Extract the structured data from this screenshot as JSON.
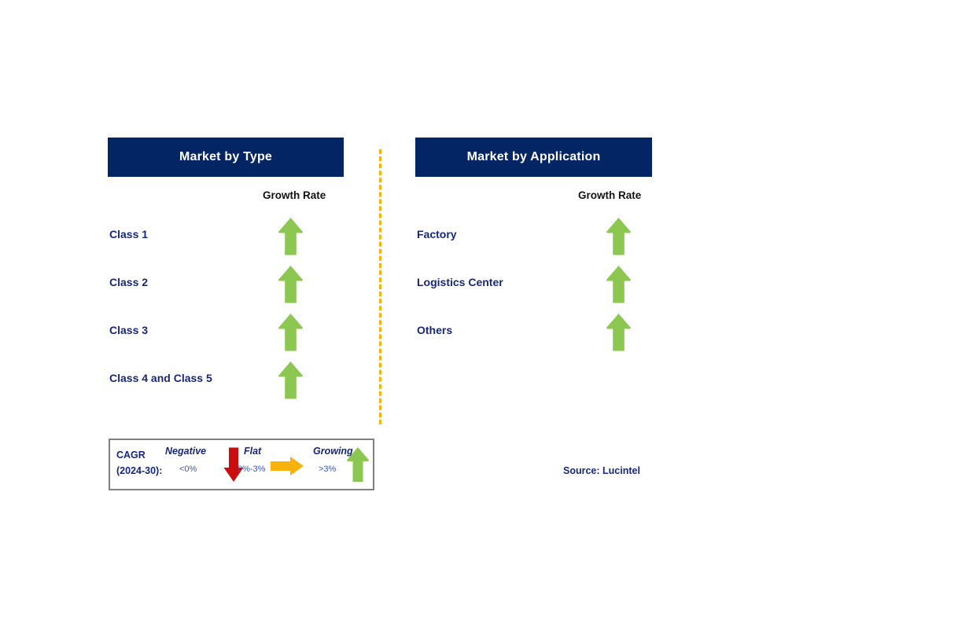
{
  "colors": {
    "header_navy": "#042563",
    "label_navy": "#17277e",
    "growing_green": "#8cc751",
    "flat_orange": "#f9b20b",
    "negative_red": "#cc0d0d",
    "divider_orange": "#f9b20b",
    "legend_border_gray": "#808080"
  },
  "panels": [
    {
      "id": "type",
      "title": "Market by Type",
      "growth_caption": "Growth Rate",
      "rows": [
        {
          "label": "Class 1",
          "growth": "Growing"
        },
        {
          "label": "Class 2",
          "growth": "Growing"
        },
        {
          "label": "Class 3",
          "growth": "Growing"
        },
        {
          "label": "Class 4 and Class 5",
          "growth": "Growing"
        }
      ]
    },
    {
      "id": "application",
      "title": "Market by Application",
      "growth_caption": "Growth Rate",
      "rows": [
        {
          "label": "Factory",
          "growth": "Growing"
        },
        {
          "label": "Logistics Center",
          "growth": "Growing"
        },
        {
          "label": "Others",
          "growth": "Growing"
        }
      ]
    }
  ],
  "legend": {
    "cagr_line1": "CAGR",
    "cagr_line2": "(2024-30):",
    "items": [
      {
        "name": "Negative",
        "range": "<0%",
        "icon": "arrow-down-icon",
        "color": "#cc0d0d"
      },
      {
        "name": "Flat",
        "range": "0%-3%",
        "icon": "arrow-right-icon",
        "color": "#f9b20b"
      },
      {
        "name": "Growing",
        "range": ">3%",
        "icon": "arrow-up-icon",
        "color": "#8cc751"
      }
    ]
  },
  "source": "Source: Lucintel"
}
